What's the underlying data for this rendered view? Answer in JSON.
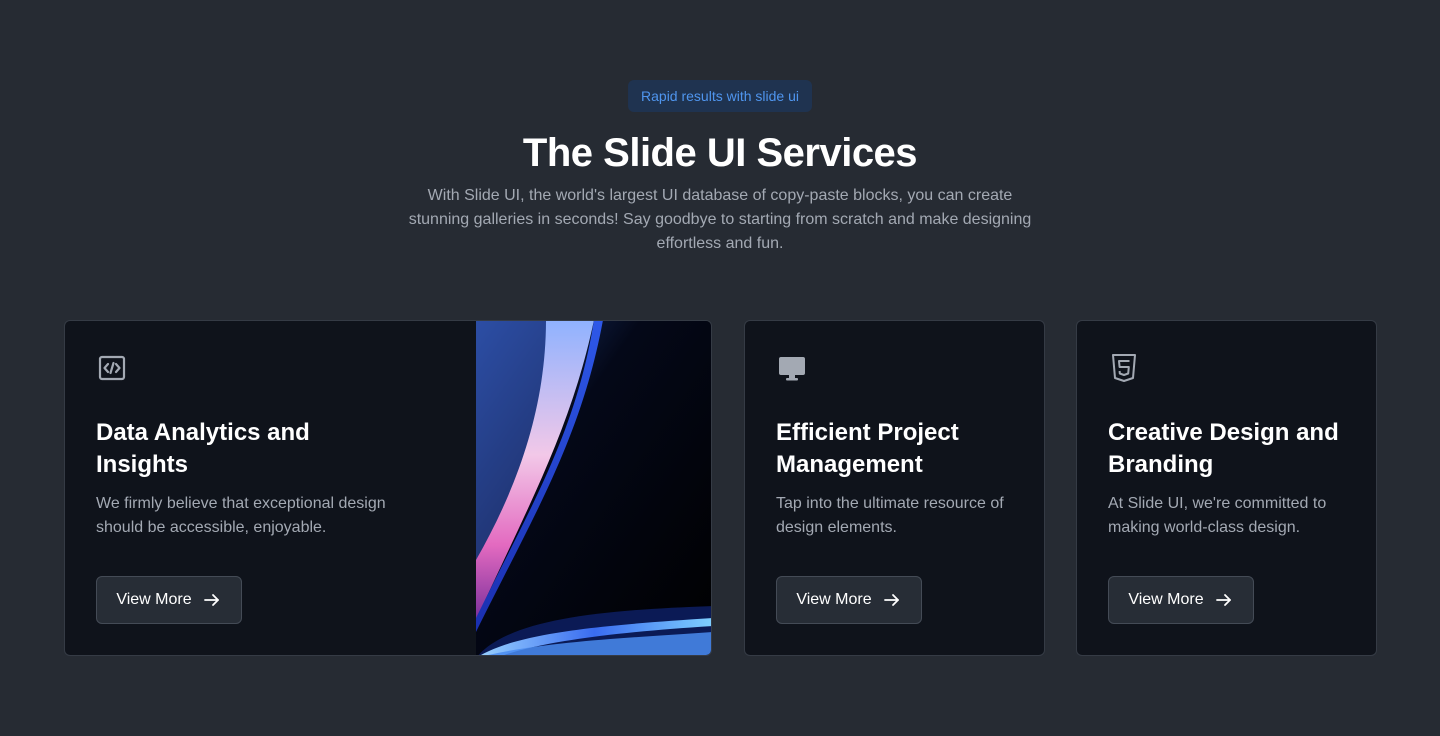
{
  "header": {
    "badge": "Rapid results with slide ui",
    "title": "The Slide UI Services",
    "subtitle": "With Slide UI, the world's largest UI database of copy-paste blocks, you can create stunning galleries in seconds! Say goodbye to starting from scratch and make designing effortless and fun."
  },
  "cards": [
    {
      "icon": "code-icon",
      "title": "Data Analytics and Insights",
      "description": "We firmly believe that exceptional design should be accessible, enjoyable.",
      "button_label": "View More"
    },
    {
      "icon": "monitor-icon",
      "title": "Efficient Project Management",
      "description": "Tap into the ultimate resource of design elements.",
      "button_label": "View More"
    },
    {
      "icon": "html5-icon",
      "title": "Creative Design and Branding",
      "description": "At Slide UI, we're committed to making world-class design.",
      "button_label": "View More"
    }
  ],
  "colors": {
    "background": "#262b33",
    "card": "#0f131b",
    "badge_bg": "#1f3350",
    "badge_text": "#4f95ee",
    "muted_text": "#a3a9b3"
  }
}
